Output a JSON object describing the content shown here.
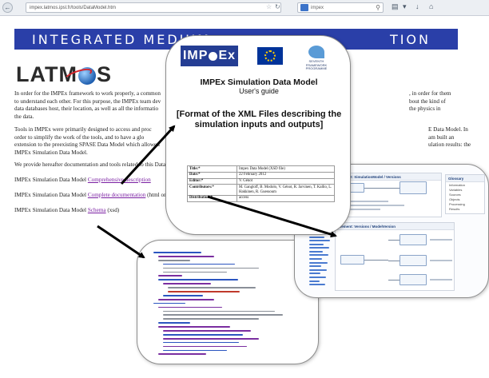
{
  "browser": {
    "url": "impex.latmos.ipsl.fr/tools/DataModel.htm",
    "search_placeholder": "impex",
    "icons": [
      "back-icon",
      "reload-icon",
      "star-icon",
      "search-icon",
      "bookmarks-icon",
      "download-icon",
      "home-icon"
    ]
  },
  "page": {
    "banner_left": "INTEGRATED MEDIUM",
    "banner_right": "TION",
    "logo_text_left": "LATM",
    "logo_text_right": "S",
    "paragraph1": {
      "left_lines": [
        "In order for the IMPEx framework to work properly, a common",
        "to understand each other. For this purpose, the IMPEx team dev",
        "data databases host, their location, as well as all the informatio",
        "the data."
      ],
      "right_lines": [
        ", in order for them",
        "bout the kind of",
        "the physics in"
      ]
    },
    "paragraph2": {
      "left_lines": [
        "Tools in IMPEx were primarily designed to access and proc",
        "order to simplify the work of the tools, and to have a glo",
        "extension to the preexisting SPASE Data Model which allowed",
        "IMPEx Simulation Data Model."
      ],
      "right_lines": [
        "E Data Model. In",
        "am built an",
        "ulation results: the"
      ]
    },
    "paragraph3": "We provide hereafter documentation and tools related to this Data",
    "links": [
      {
        "prefix": "IMPEx Simulation Data Model ",
        "link": "Comprehensive description",
        "suffix": ""
      },
      {
        "prefix": "IMPEx Simulation Data Model ",
        "link": "Complete documentation",
        "suffix": " (html or pdf)"
      },
      {
        "prefix": "IMPEx Simulation Data Model ",
        "link": "Schema",
        "suffix": " (xsd)"
      }
    ]
  },
  "doc_card": {
    "logo_impex": "IMP",
    "logo_impex_suffix": "Ex",
    "fp7_text": "SEVENTH FRAMEWORK PROGRAMME",
    "title": "IMPEx Simulation Data Model",
    "subtitle": "User's  guide",
    "section": "[Format of the XML Files describing the simulation inputs and outputs]",
    "table": [
      {
        "k": "Title:*",
        "v": "Impex Data Model (XSD file)"
      },
      {
        "k": "Date:*",
        "v": "22 February 2012"
      },
      {
        "k": "Editor:*",
        "v": "V. Génot"
      },
      {
        "k": "Contributors:*",
        "v": "M. Gangloff, B. Modolo, V. Génot, R. Jarvinen, T. Kallio, L. Hakkinen, R. Guessoum"
      },
      {
        "k": "Distribution:*",
        "v": "access"
      }
    ]
  },
  "ui_card": {
    "panel1_title": "Element: SimulationModel / Versions",
    "panel2_title": "Element: Versions / ModelVersion",
    "right_title": "Glossary",
    "right_items": [
      "Information",
      "Variables",
      "Sources",
      "Objects",
      "Processing",
      "Results"
    ]
  }
}
